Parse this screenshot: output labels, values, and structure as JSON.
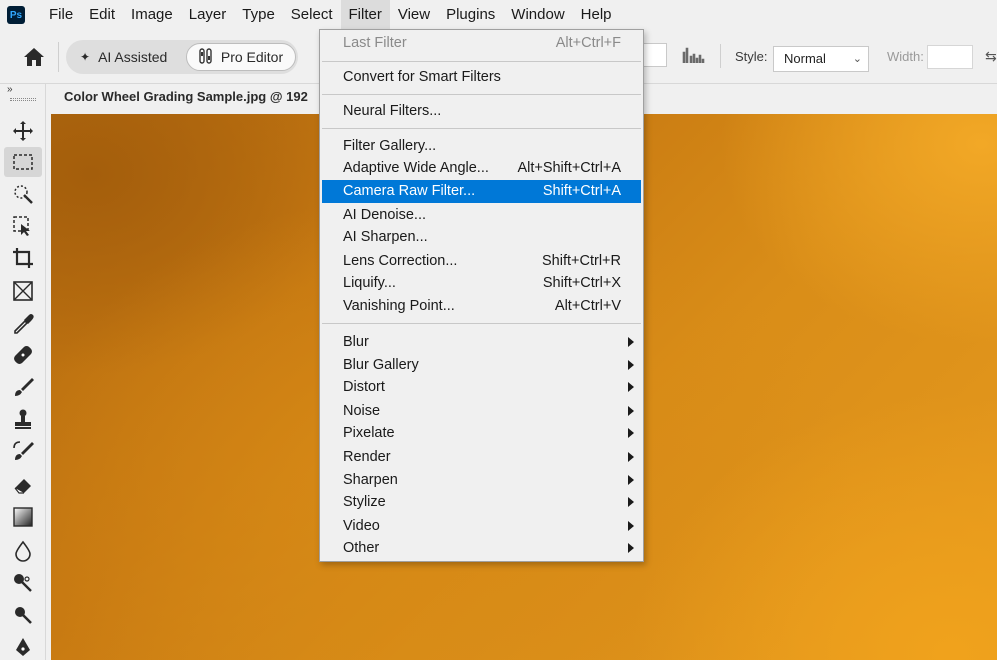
{
  "app": {
    "logo_text": "Ps"
  },
  "menubar": {
    "items": [
      "File",
      "Edit",
      "Image",
      "Layer",
      "Type",
      "Select",
      "Filter",
      "View",
      "Plugins",
      "Window",
      "Help"
    ]
  },
  "options": {
    "ai_assisted_label": "AI Assisted",
    "pro_editor_label": "Pro Editor",
    "style_label": "Style:",
    "style_value": "Normal",
    "width_label": "Width:"
  },
  "document": {
    "tab_title": "Color Wheel Grading Sample.jpg @ 192"
  },
  "filter_menu": {
    "last_filter": {
      "label": "Last Filter",
      "shortcut": "Alt+Ctrl+F"
    },
    "convert_smart": {
      "label": "Convert for Smart Filters"
    },
    "neural": {
      "label": "Neural Filters..."
    },
    "filter_gallery": {
      "label": "Filter Gallery..."
    },
    "adaptive_wide": {
      "label": "Adaptive Wide Angle...",
      "shortcut": "Alt+Shift+Ctrl+A"
    },
    "camera_raw": {
      "label": "Camera Raw Filter...",
      "shortcut": "Shift+Ctrl+A"
    },
    "ai_denoise": {
      "label": "AI Denoise..."
    },
    "ai_sharpen": {
      "label": "AI Sharpen..."
    },
    "lens_correction": {
      "label": "Lens Correction...",
      "shortcut": "Shift+Ctrl+R"
    },
    "liquify": {
      "label": "Liquify...",
      "shortcut": "Shift+Ctrl+X"
    },
    "vanishing_point": {
      "label": "Vanishing Point...",
      "shortcut": "Alt+Ctrl+V"
    },
    "submenus": [
      "Blur",
      "Blur Gallery",
      "Distort",
      "Noise",
      "Pixelate",
      "Render",
      "Sharpen",
      "Stylize",
      "Video",
      "Other"
    ]
  },
  "colors": {
    "highlight": "#0078d7",
    "canvas_base": "#c87a12"
  }
}
